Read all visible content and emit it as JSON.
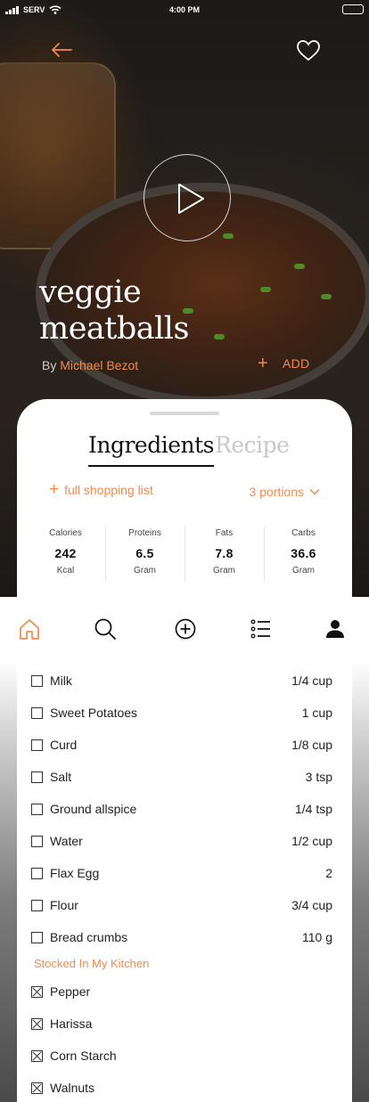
{
  "status_bar": {
    "carrier": "SERV",
    "time": "4:00 PM"
  },
  "recipe": {
    "title_line1": "veggie",
    "title_line2": "meatballs",
    "by_prefix": "By",
    "author": "Michael Bezot",
    "add_label": "ADD"
  },
  "tabs": [
    {
      "label": "Ingredients",
      "active": true
    },
    {
      "label": "Recipe",
      "active": false
    }
  ],
  "shopping_link": "full shopping list",
  "portions": "3 portions",
  "nutrition": [
    {
      "label": "Calories",
      "value": "242",
      "unit": "Kcal"
    },
    {
      "label": "Proteins",
      "value": "6.5",
      "unit": "Gram"
    },
    {
      "label": "Fats",
      "value": "7.8",
      "unit": "Gram"
    },
    {
      "label": "Carbs",
      "value": "36.6",
      "unit": "Gram"
    }
  ],
  "tab_bar": [
    "home-icon",
    "search-icon",
    "add-circle-icon",
    "list-icon",
    "profile-icon"
  ],
  "ingredients": [
    {
      "name": "Milk",
      "qty": "1/4  cup"
    },
    {
      "name": "Sweet Potatoes",
      "qty": "1 cup"
    },
    {
      "name": "Curd",
      "qty": "1/8 cup"
    },
    {
      "name": "Salt",
      "qty": "3 tsp"
    },
    {
      "name": "Ground allspice",
      "qty": "1/4 tsp"
    },
    {
      "name": "Water",
      "qty": "1/2 cup"
    },
    {
      "name": "Flax Egg",
      "qty": "2"
    },
    {
      "name": "Flour",
      "qty": "3/4 cup"
    },
    {
      "name": "Bread crumbs",
      "qty": "110 g"
    }
  ],
  "stocked_heading": "Stocked In My Kitchen",
  "stocked": [
    {
      "name": "Pepper"
    },
    {
      "name": "Harissa"
    },
    {
      "name": "Corn Starch"
    },
    {
      "name": "Walnuts"
    }
  ],
  "colors": {
    "accent": "#f08a4b",
    "inactive_tab": "#c7c7c7"
  }
}
